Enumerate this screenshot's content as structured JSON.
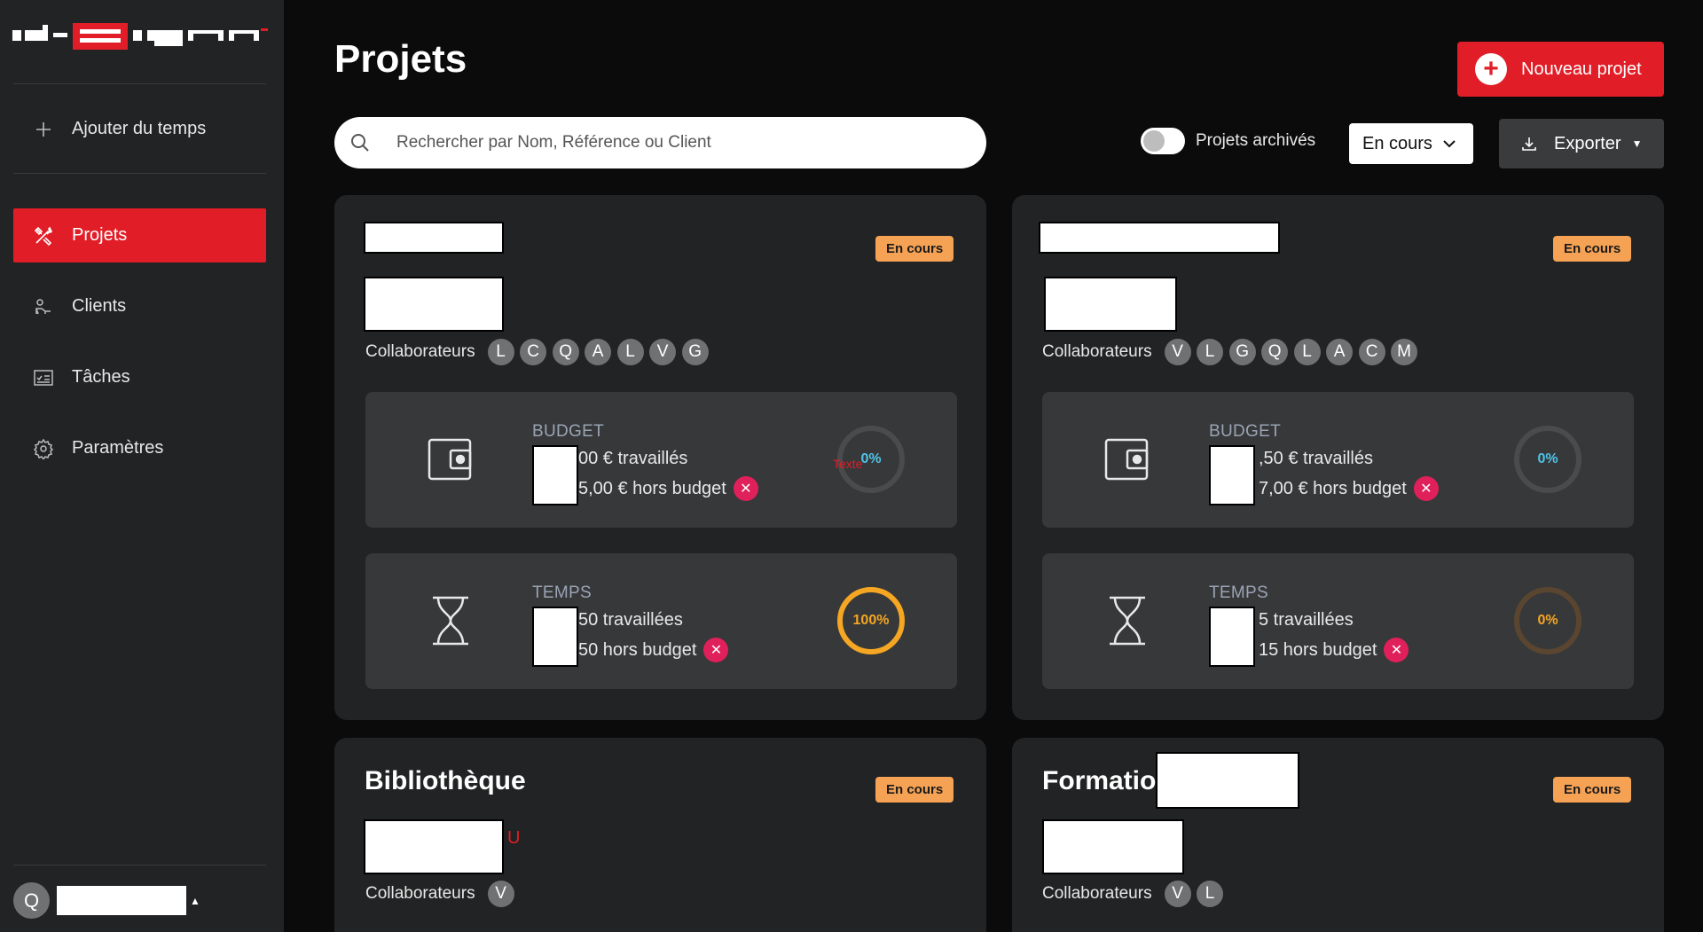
{
  "sidebar": {
    "logo_text": "id-sign",
    "add_time": "Ajouter du temps",
    "items": [
      {
        "label": "Projets",
        "icon": "tools-icon",
        "active": true
      },
      {
        "label": "Clients",
        "icon": "client-icon",
        "active": false
      },
      {
        "label": "Tâches",
        "icon": "tasks-icon",
        "active": false
      },
      {
        "label": "Paramètres",
        "icon": "gear-icon",
        "active": false
      }
    ],
    "user_initial": "Q"
  },
  "header": {
    "title": "Projets",
    "new_project": "Nouveau projet",
    "search_placeholder": "Rechercher par Nom, Référence ou Client",
    "archived_label": "Projets archivés",
    "archived_on": false,
    "status_select": "En cours",
    "export": "Exporter"
  },
  "colors": {
    "accent": "#e11d27",
    "badge": "#f5a254",
    "warn": "#e0205a",
    "gauge_orange": "#f5a623",
    "gauge_blue": "#4fc3e8"
  },
  "cards": [
    {
      "badge": "En cours",
      "collab_label": "Collaborateurs",
      "collaborators": [
        "L",
        "C",
        "Q",
        "A",
        "L",
        "V",
        "G"
      ],
      "budget": {
        "label": "BUDGET",
        "line1": "00 € travaillés",
        "line2": "5,00 € hors budget",
        "percent": "0%",
        "progress": 0,
        "overlay": "Texte"
      },
      "temps": {
        "label": "TEMPS",
        "line1": "50 travaillées",
        "line2": "50 hors budget",
        "percent": "100%",
        "progress": 100
      }
    },
    {
      "badge": "En cours",
      "collab_label": "Collaborateurs",
      "collaborators": [
        "V",
        "L",
        "G",
        "Q",
        "L",
        "A",
        "C",
        "M"
      ],
      "budget": {
        "label": "BUDGET",
        "line1": ",50 € travaillés",
        "line2": "7,00 € hors budget",
        "percent": "0%",
        "progress": 0
      },
      "temps": {
        "label": "TEMPS",
        "line1": "5 travaillées",
        "line2": "15 hors budget",
        "percent": "0%",
        "progress": 0
      }
    },
    {
      "title": "Bibliothèque",
      "badge": "En cours",
      "collab_label": "Collaborateurs",
      "collaborators": [
        "V"
      ],
      "extra": "U"
    },
    {
      "title": "Formatio",
      "badge": "En cours",
      "collab_label": "Collaborateurs",
      "collaborators": [
        "V",
        "L"
      ]
    }
  ]
}
